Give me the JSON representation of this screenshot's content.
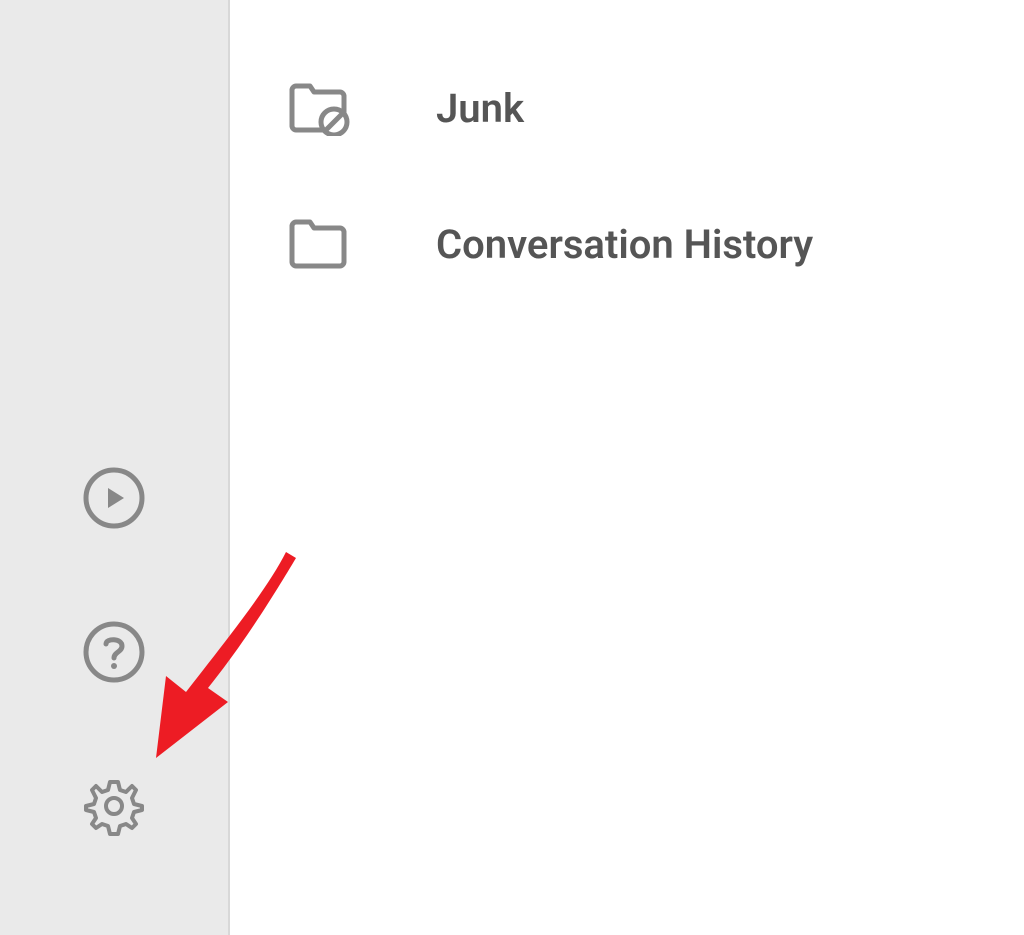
{
  "folders": [
    {
      "label": "Junk",
      "icon": "folder-junk"
    },
    {
      "label": "Conversation History",
      "icon": "folder"
    }
  ],
  "sidebar": {
    "play_label": "Play",
    "help_label": "Help",
    "settings_label": "Settings"
  },
  "colors": {
    "icon_stroke": "#777777",
    "text": "#555555",
    "sidebar_bg": "#eaeaea",
    "arrow": "#ed1c24"
  }
}
